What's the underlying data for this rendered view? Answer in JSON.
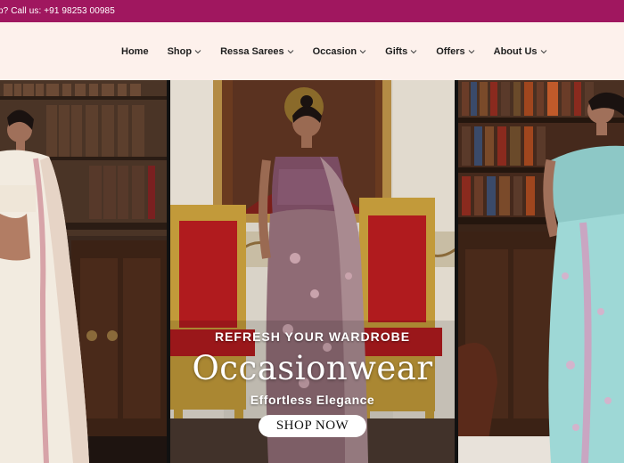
{
  "topbar": {
    "text": "p? Call us: +91 98253 00985"
  },
  "nav": {
    "items": [
      {
        "label": "Home",
        "has_dropdown": false
      },
      {
        "label": "Shop",
        "has_dropdown": true
      },
      {
        "label": "Ressa Sarees",
        "has_dropdown": true
      },
      {
        "label": "Occasion",
        "has_dropdown": true
      },
      {
        "label": "Gifts",
        "has_dropdown": true
      },
      {
        "label": "Offers",
        "has_dropdown": true
      },
      {
        "label": "About Us",
        "has_dropdown": true
      }
    ]
  },
  "hero": {
    "kicker": "REFRESH YOUR WARDROBE",
    "headline": "Occasionwear",
    "tagline": "Effortless Elegance",
    "cta_label": "SHOP NOW"
  },
  "colors": {
    "topbar_bg": "#a0175f",
    "nav_bg": "#fdf1ec",
    "cta_bg": "#ffffff"
  }
}
